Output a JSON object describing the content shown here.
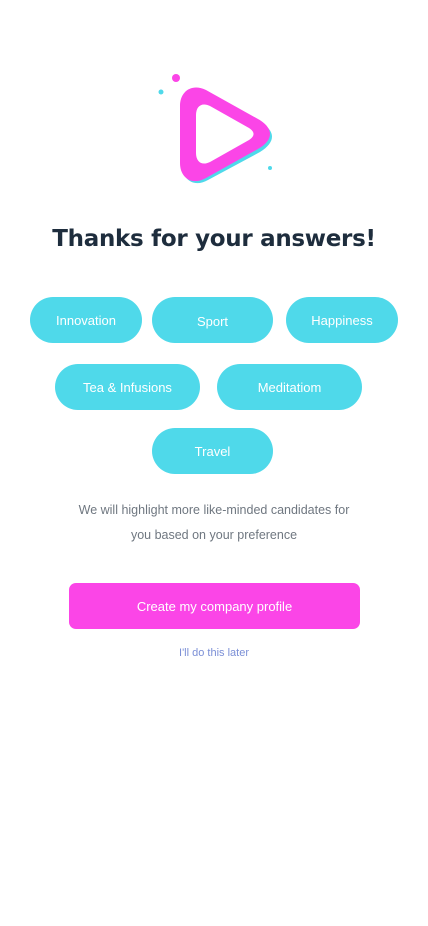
{
  "title": "Thanks for your answers!",
  "interests": [
    "Innovation",
    "Sport",
    "Happiness",
    "Tea & Infusions",
    "Meditatiom",
    "Travel"
  ],
  "description": {
    "line1": "We will highlight more like-minded candidates for",
    "line2": "you based on your preference"
  },
  "primary_button": "Create my company profile",
  "skip_link": "I'll do this later",
  "colors": {
    "accent_pink": "#fb45e7",
    "accent_cyan": "#4fd9ea",
    "title_text": "#1e2d3d",
    "body_text": "#6f7780",
    "link_text": "#7b8fd6"
  }
}
